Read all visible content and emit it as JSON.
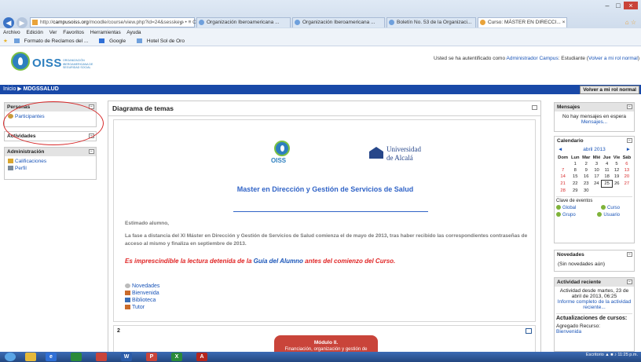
{
  "browser": {
    "address_prefix": "http://",
    "address_host": "campusoiss.org",
    "address_rest": "/moodle/course/view.php?id=24&sesskey-",
    "address_controls": "ρ • ≡ C",
    "tabs": [
      {
        "label": "Organización Iberoamericana ..."
      },
      {
        "label": "Organización Iberoamericana ..."
      },
      {
        "label": "Boletín No. 53 de la Organizaci..."
      },
      {
        "label": "Curso: MÁSTER EN DIRECCI..."
      }
    ],
    "tab_close": "×",
    "menu": [
      "Archivo",
      "Edición",
      "Ver",
      "Favoritos",
      "Herramientas",
      "Ayuda"
    ],
    "favorites": [
      "Formato de Reclamos del ...",
      "Google",
      "Hotel Sol de Oro"
    ]
  },
  "header": {
    "logo_text": "OISS",
    "logo_sub": "ORGANIZACIÓN IBEROAMERICANA DE SEGURIDAD SOCIAL",
    "login_prefix": "Usted se ha autentificado como ",
    "login_user": "Administrador Campus",
    "login_mid": ": Estudiante (",
    "login_link": "Volver a mi rol normal",
    "login_suffix": ")"
  },
  "navbar": {
    "home": "Inicio",
    "separator": "▶",
    "current": "MDGSSALUD",
    "role_button": "Volver a mi rol normal"
  },
  "left": {
    "personas": {
      "title": "Personas",
      "items": [
        "Participantes"
      ]
    },
    "actividades": {
      "title": "Actividades"
    },
    "admin": {
      "title": "Administración",
      "items": [
        "Calificaciones",
        "Perfil"
      ]
    }
  },
  "center": {
    "title": "Diagrama de temas",
    "uni_line1": "Universidad",
    "uni_line2": "de Alcalá",
    "oiss_label": "OISS",
    "master_title": "Master en Dirección y Gestión de Servicios de Salud",
    "greeting": "Estimado alumno,",
    "paragraph": "La fase a distancia del XI Máster en Dirección y Gestión de Servicios de Salud comienza el  de mayo de 2013, tras haber recibido las correspondientes contraseñas de acceso al mismo y finaliza en septiembre de 2013.",
    "notice_pre": "Es imprescindible la lectura detenida de la ",
    "notice_link": "Guía del Alumno",
    "notice_post": " antes del comienzo del Curso.",
    "resources": [
      "Novedades",
      "Bienvenida",
      "Biblioteca",
      "Tutor"
    ],
    "section2_number": "2",
    "module_title": "Módulo II.",
    "module_sub": "Financiación, organización y gestión de"
  },
  "right": {
    "mensajes": {
      "title": "Mensajes",
      "text": "No hay mensajes en espera",
      "link": "Mensajes..."
    },
    "calendario": {
      "title": "Calendario",
      "prev": "◄",
      "next": "►",
      "month": "abril 2013",
      "days": [
        "Dom",
        "Lun",
        "Mar",
        "Mié",
        "Jue",
        "Vie",
        "Sáb"
      ],
      "weeks": [
        [
          "",
          "1",
          "2",
          "3",
          "4",
          "5",
          "6"
        ],
        [
          "7",
          "8",
          "9",
          "10",
          "11",
          "12",
          "13"
        ],
        [
          "14",
          "15",
          "16",
          "17",
          "18",
          "19",
          "20"
        ],
        [
          "21",
          "22",
          "23",
          "24",
          "25",
          "26",
          "27"
        ],
        [
          "28",
          "29",
          "30",
          "",
          "",
          "",
          ""
        ]
      ],
      "today": "25",
      "clave": "Clave de eventos",
      "events": [
        "Global",
        "Curso",
        "Grupo",
        "Usuario"
      ]
    },
    "novedades": {
      "title": "Novedades",
      "text": "(Sin novedades aún)"
    },
    "actividad": {
      "title": "Actividad reciente",
      "text": "Actividad desde martes, 23 de abril de 2013, 06:25",
      "link": "Informe completo de la actividad reciente..."
    },
    "actualizaciones": {
      "title": "Actualizaciones de cursos:",
      "text": "Agregado Recurso:",
      "link": "Bienvenida"
    }
  },
  "taskbar": {
    "desktop": "Escritorio",
    "time": "11:25 p.m."
  }
}
